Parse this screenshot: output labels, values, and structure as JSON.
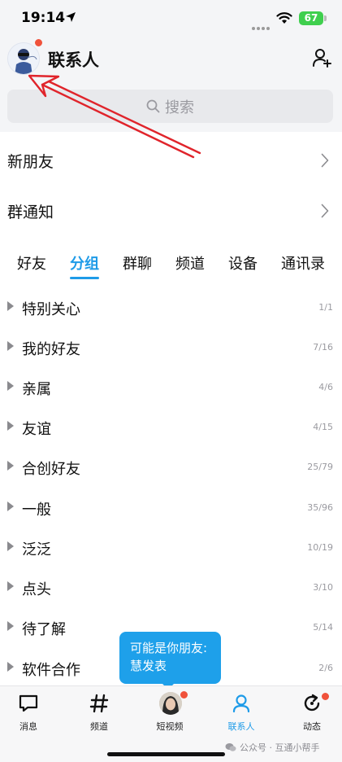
{
  "status_bar": {
    "time": "19:14",
    "battery": "67"
  },
  "header": {
    "title": "联系人"
  },
  "search": {
    "placeholder": "搜索"
  },
  "rows": [
    {
      "label": "新朋友"
    },
    {
      "label": "群通知"
    }
  ],
  "tabs": [
    {
      "label": "好友"
    },
    {
      "label": "分组"
    },
    {
      "label": "群聊"
    },
    {
      "label": "频道"
    },
    {
      "label": "设备"
    },
    {
      "label": "通讯录"
    }
  ],
  "active_tab": "分组",
  "groups": [
    {
      "name": "特别关心",
      "count": "1/1"
    },
    {
      "name": "我的好友",
      "count": "7/16"
    },
    {
      "name": "亲属",
      "count": "4/6"
    },
    {
      "name": "友谊",
      "count": "4/15"
    },
    {
      "name": "合创好友",
      "count": "25/79"
    },
    {
      "name": "一般",
      "count": "35/96"
    },
    {
      "name": "泛泛",
      "count": "10/19"
    },
    {
      "name": "点头",
      "count": "3/10"
    },
    {
      "name": "待了解",
      "count": "5/14"
    },
    {
      "name": "软件合作",
      "count": "2/6"
    }
  ],
  "tooltip": {
    "line1": "可能是你朋友:",
    "line2": "慧发表"
  },
  "bottom_nav": [
    {
      "label": "消息",
      "icon": "message-icon"
    },
    {
      "label": "频道",
      "icon": "hash-icon"
    },
    {
      "label": "短视频",
      "icon": "video-avatar"
    },
    {
      "label": "联系人",
      "icon": "contacts-icon"
    },
    {
      "label": "动态",
      "icon": "refresh-icon"
    }
  ],
  "watermark": "公众号 · 互通小帮手",
  "colors": {
    "accent": "#1e9be8",
    "badge": "#f0523b",
    "annotation": "#e0242b"
  }
}
